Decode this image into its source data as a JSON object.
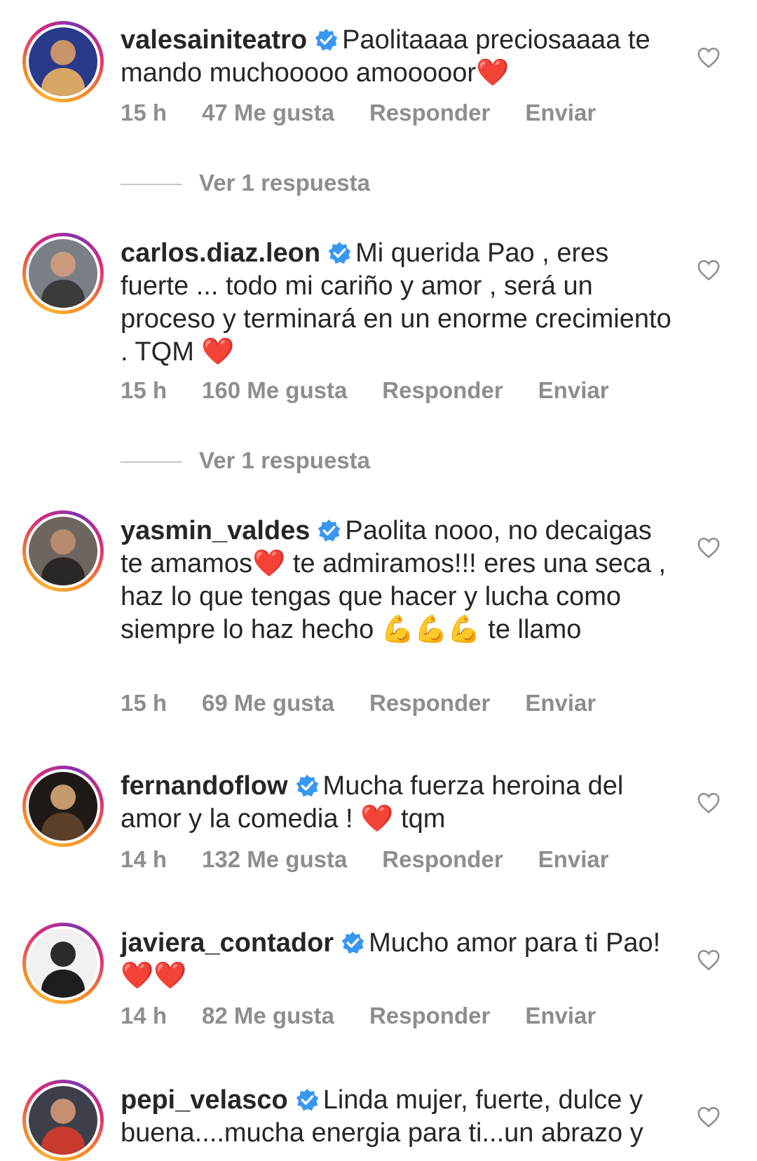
{
  "comments": [
    {
      "username": "valesainiteatro",
      "text": "Paolitaaaa preciosaaaa te mando muchooooo amooooor",
      "emoji": "❤️",
      "time": "15 h",
      "likes": "47 Me gusta",
      "reply": "Responder",
      "send": "Enviar",
      "view_replies": "Ver 1 respuesta"
    },
    {
      "username": "carlos.diaz.leon",
      "text": "Mi querida Pao , eres fuerte ... todo mi cariño y amor , será un proceso y terminará en un enorme crecimiento . TQM",
      "emoji": "❤️",
      "time": "15 h",
      "likes": "160 Me gusta",
      "reply": "Responder",
      "send": "Enviar",
      "view_replies": "Ver 1 respuesta"
    },
    {
      "username": "yasmin_valdes",
      "text_a": "Paolita nooo, no decaigas te amamos",
      "emoji_a": "❤️",
      "text_b": "te admiramos!!! eres una seca , haz lo que tengas que hacer y lucha como siempre lo haz hecho",
      "emoji_b": "💪💪💪",
      "text_c": "te llamo",
      "time": "15 h",
      "likes": "69 Me gusta",
      "reply": "Responder",
      "send": "Enviar"
    },
    {
      "username": "fernandoflow",
      "text_a": "Mucha fuerza heroina del amor y la comedia !",
      "emoji": "❤️",
      "text_b": "tqm",
      "time": "14 h",
      "likes": "132 Me gusta",
      "reply": "Responder",
      "send": "Enviar"
    },
    {
      "username": "javiera_contador",
      "text": "Mucho amor para ti Pao!",
      "emoji": "❤️❤️",
      "time": "14 h",
      "likes": "82 Me gusta",
      "reply": "Responder",
      "send": "Enviar"
    },
    {
      "username": "pepi_velasco",
      "text": "Linda mujer, fuerte, dulce y buena....mucha energia para ti...un abrazo y"
    }
  ],
  "icons": {
    "verified": "verified-badge-icon",
    "like": "heart-outline-icon"
  },
  "colors": {
    "verified_blue": "#3897f0",
    "meta_gray": "#8e8e8e",
    "heart_red": "#e0161e"
  }
}
